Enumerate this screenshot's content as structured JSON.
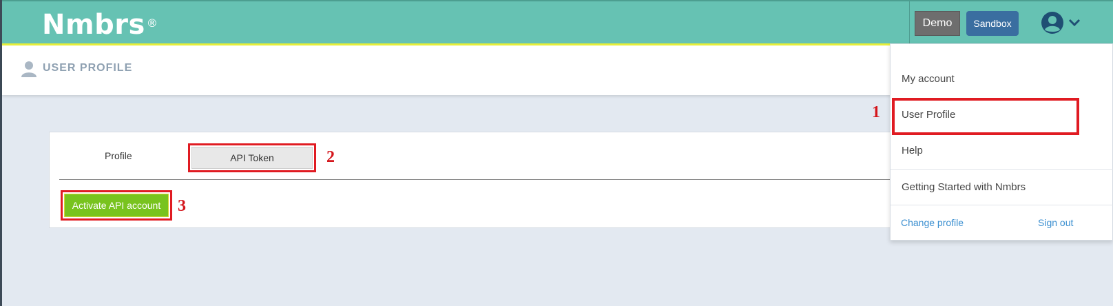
{
  "app": {
    "logo": "Nmbrs",
    "logo_mark": "®",
    "environment_badge": "Demo",
    "sandbox_badge": "Sandbox",
    "user_icon": "user-circle-icon",
    "chevron_icon": "chevron-down-icon"
  },
  "page_header": {
    "icon": "person-icon",
    "title": "USER PROFILE"
  },
  "tabs": [
    {
      "label": "Profile",
      "selected": false
    },
    {
      "label": "API Token",
      "selected": true
    }
  ],
  "actions": {
    "activate_label": "Activate API account"
  },
  "annotations": {
    "step1": "1",
    "step2": "2",
    "step3": "3"
  },
  "user_menu": {
    "items": [
      "My account",
      "User Profile",
      "Help",
      "Getting Started with Nmbrs"
    ],
    "change_profile": "Change profile",
    "sign_out": "Sign out"
  },
  "colors": {
    "header_teal": "#66c2b3",
    "accent_yellow": "#e8ef3a",
    "activate_green": "#78c31e",
    "sandbox_blue": "#3a6ea0",
    "annotation_red": "#e01b22",
    "link_blue": "#3b8fd0"
  }
}
